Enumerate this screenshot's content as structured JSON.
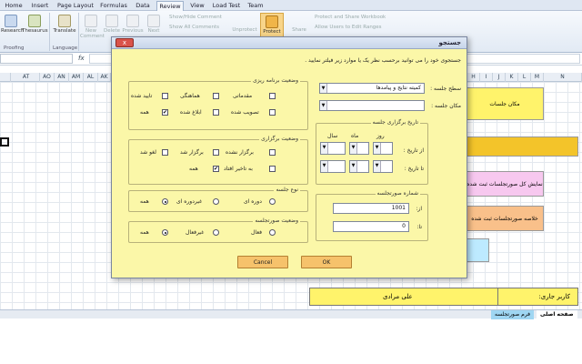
{
  "tabs": [
    "Home",
    "Insert",
    "Page Layout",
    "Formulas",
    "Data",
    "Review",
    "View",
    "Load Test",
    "Team"
  ],
  "active_tab": "Review",
  "ribbon": {
    "research": "Research",
    "thesaurus": "Thesaurus",
    "translate": "Translate",
    "new_comment": "New Comment",
    "delete": "Delete",
    "previous": "Previous",
    "next": "Next",
    "show_hide": "Show/Hide Comment",
    "show_all": "Show All Comments",
    "unprotect": "Unprotect",
    "protect": "Protect",
    "share": "Share",
    "protect_share": "Protect and Share Workbook",
    "allow_users": "Allow Users to Edit Ranges",
    "group_proofing": "Proofing",
    "group_language": "Language"
  },
  "formula_bar": {
    "fx": "fx"
  },
  "columns": [
    "AT",
    "AO",
    "AN",
    "AM",
    "AL",
    "AK"
  ],
  "right_columns": [
    "H",
    "I",
    "J",
    "K",
    "L",
    "M",
    "N"
  ],
  "sheet": {
    "btn_places": "مکان جلسات",
    "btn_show": "نمایش کل صورتجلسات ثبت شده",
    "btn_summary": "خلاصه صورتجلسات ثبت شده",
    "current_user_label": "کاربر جاری:",
    "current_user": "علی مرادی"
  },
  "sheet_tabs": [
    "صفحه اصلی",
    "فرم صورتجلسه"
  ],
  "dialog": {
    "title": "جستجو",
    "close": "x",
    "instruction": "جستجوی خود را می توانید برحسب نظر یک یا موارد زیر فیلتر نمایید .",
    "level_label": "سطح جلسه :",
    "level_value": "کمیته نتایج و پیامدها",
    "place_label": "مکان جلسه :",
    "place_value": "",
    "date_group": "تاریخ برگزاری جلسه",
    "day": "روز",
    "month": "ماه",
    "year": "سال",
    "from_date": "از تاریخ :",
    "to_date": "تا تاریخ :",
    "number_group": "شماره صورتجلسه",
    "from": "از:",
    "to": "تا:",
    "from_value": "1001",
    "to_value": "0",
    "planning_group": "وضعیت برنامه ریزی",
    "planning": [
      {
        "label": "مقدماتی",
        "checked": false
      },
      {
        "label": "هماهنگی",
        "checked": false
      },
      {
        "label": "تایید شده",
        "checked": false
      },
      {
        "label": "تصویب شده",
        "checked": false
      },
      {
        "label": "ابلاغ شده",
        "checked": false
      },
      {
        "label": "همه",
        "checked": true
      }
    ],
    "holding_group": "وضعیت برگزاری",
    "holding": [
      {
        "label": "برگزار نشده",
        "checked": false
      },
      {
        "label": "برگزار شد",
        "checked": false
      },
      {
        "label": "لغو شد",
        "checked": false
      },
      {
        "label": "به تاخیر افتاد",
        "checked": false
      },
      {
        "label": "همه",
        "checked": true
      }
    ],
    "type_group": "نوع جلسه",
    "types": [
      {
        "label": "دوره ای",
        "on": false
      },
      {
        "label": "غیردوره ای",
        "on": false
      },
      {
        "label": "همه",
        "on": true
      }
    ],
    "minutes_group": "وضعیت صورتجلسه",
    "minutes": [
      {
        "label": "فعال",
        "on": false
      },
      {
        "label": "غیرفعال",
        "on": false
      },
      {
        "label": "همه",
        "on": true
      }
    ],
    "cancel": "Cancel",
    "ok": "OK"
  },
  "colors": {
    "accent": "#f6c26b",
    "dialog_bg": "#fbf7a8"
  }
}
